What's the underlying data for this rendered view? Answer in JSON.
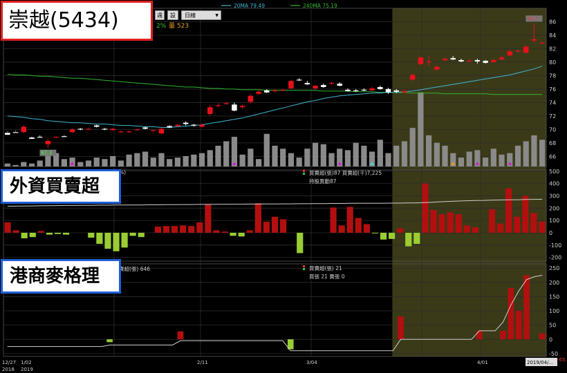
{
  "title": "崇越(5434)",
  "panel_labels": {
    "foreign": "外資買賣超",
    "hk": "港商麥格理"
  },
  "toolbar": {
    "btn1": "週",
    "btn2": "設",
    "period_select": "日線"
  },
  "ma_legend": [
    {
      "label": "20MA 79.49",
      "color": "#3fb7d6"
    },
    {
      "label": "240MA 75.19",
      "color": "#2eb82e"
    }
  ],
  "info_line": {
    "pct": "2%",
    "vol": "量 523"
  },
  "price_labels": {
    "high": "85.7",
    "low": "67.3",
    "last": "-65.8"
  },
  "foreign_info": {
    "line1": "買賣超(張)87  買賣超(千)7,225",
    "line2": "持股異動87",
    "cut": "%)"
  },
  "hk_info": {
    "line1": "買賣超(張) 21",
    "line2": "買張 21  賣張 0",
    "cut": "賣超(張) 646"
  },
  "x_labels": {
    "l1": "12/27",
    "l1b": "2018",
    "l2": "1/02",
    "l2b": "2019",
    "l3": "2/11",
    "l4": "3/04",
    "l5": "4/01",
    "l6": "2019/04/..."
  },
  "colors": {
    "up": "#e8101a",
    "down": "#ffffff",
    "vol": "#8a8a8a",
    "pos_bar": "#b30f0f",
    "neg_bar": "#9acd32",
    "highlight": "#3a3a18",
    "grid": "#2c2c2c"
  },
  "chart_data": [
    {
      "type": "candlestick",
      "title": "崇越(5434)",
      "ylim": [
        64.5,
        88
      ],
      "yticks": [
        66,
        68,
        70,
        72,
        74,
        76,
        78,
        80,
        82,
        84,
        86
      ],
      "candles": [
        [
          69.5,
          69.2,
          69.7,
          69.6
        ],
        [
          69.6,
          69.5,
          69.8,
          69.7
        ],
        [
          69.6,
          70.4,
          70.6,
          69.5
        ],
        [
          68.8,
          68.6,
          68.9,
          68.7
        ],
        [
          68.9,
          68.8,
          69.1,
          68.9
        ],
        [
          67.8,
          68.3,
          68.5,
          67.3
        ],
        [
          68.8,
          68.9,
          69.0,
          68.8
        ],
        [
          69.0,
          68.9,
          69.1,
          68.9
        ],
        [
          69.6,
          70.0,
          70.2,
          69.5
        ],
        [
          70.1,
          70.0,
          70.2,
          69.9
        ],
        [
          70.0,
          70.1,
          70.2,
          69.9
        ],
        [
          70.6,
          70.4,
          70.7,
          70.3
        ],
        [
          70.1,
          70.0,
          70.2,
          69.9
        ],
        [
          69.9,
          70.1,
          70.2,
          69.8
        ],
        [
          69.6,
          69.7,
          69.8,
          69.5
        ],
        [
          69.6,
          69.7,
          69.8,
          69.5
        ],
        [
          69.9,
          70.0,
          70.1,
          69.8
        ],
        [
          70.3,
          70.1,
          70.4,
          70.0
        ],
        [
          69.8,
          69.9,
          70.0,
          69.7
        ],
        [
          69.4,
          70.1,
          70.3,
          69.3
        ],
        [
          70.5,
          70.3,
          70.6,
          70.2
        ],
        [
          70.5,
          70.7,
          70.8,
          70.4
        ],
        [
          71.0,
          70.8,
          71.2,
          70.6
        ],
        [
          70.7,
          70.6,
          70.8,
          70.4
        ],
        [
          70.4,
          70.7,
          70.9,
          70.3
        ],
        [
          72.3,
          73.3,
          73.6,
          72.1
        ],
        [
          73.6,
          73.6,
          73.9,
          73.3
        ],
        [
          73.9,
          73.9,
          74.1,
          73.7
        ],
        [
          73.7,
          72.8,
          74.0,
          72.7
        ],
        [
          73.3,
          73.5,
          73.7,
          73.1
        ],
        [
          74.1,
          75.0,
          75.2,
          73.9
        ],
        [
          75.3,
          75.6,
          75.8,
          75.1
        ],
        [
          75.8,
          75.5,
          76.0,
          75.4
        ],
        [
          75.7,
          75.8,
          76.0,
          75.5
        ],
        [
          75.8,
          75.9,
          76.0,
          75.7
        ],
        [
          76.1,
          77.2,
          77.4,
          76.0
        ],
        [
          77.4,
          77.3,
          77.6,
          77.2
        ],
        [
          76.9,
          76.7,
          77.2,
          76.6
        ],
        [
          76.1,
          76.5,
          76.6,
          75.9
        ],
        [
          76.6,
          76.3,
          76.8,
          76.2
        ],
        [
          76.8,
          76.9,
          77.1,
          76.7
        ],
        [
          76.8,
          76.5,
          77.0,
          76.4
        ],
        [
          75.9,
          75.7,
          76.1,
          75.6
        ],
        [
          75.8,
          75.7,
          76.0,
          75.6
        ],
        [
          75.9,
          75.8,
          76.1,
          75.7
        ],
        [
          75.8,
          76.1,
          76.3,
          75.7
        ],
        [
          76.3,
          76.0,
          76.5,
          75.9
        ],
        [
          76.0,
          75.5,
          76.2,
          75.3
        ],
        [
          75.8,
          75.6,
          76.0,
          75.4
        ],
        [
          75.5,
          75.7,
          75.9,
          75.4
        ],
        [
          77.4,
          78.1,
          78.3,
          77.2
        ],
        [
          79.7,
          80.7,
          80.9,
          79.5
        ],
        [
          80.1,
          80.1,
          80.9,
          79.4
        ],
        [
          78.9,
          79.3,
          79.5,
          78.8
        ],
        [
          80.3,
          80.5,
          80.7,
          80.1
        ],
        [
          80.6,
          80.4,
          80.9,
          80.3
        ],
        [
          80.3,
          80.1,
          80.5,
          80.0
        ],
        [
          80.2,
          80.2,
          80.4,
          80.0
        ],
        [
          80.3,
          80.1,
          80.5,
          79.8
        ],
        [
          80.2,
          79.9,
          80.3,
          79.8
        ],
        [
          80.0,
          80.3,
          80.5,
          79.9
        ],
        [
          80.4,
          80.7,
          80.9,
          80.3
        ],
        [
          81.0,
          81.6,
          81.8,
          80.9
        ],
        [
          81.6,
          81.7,
          81.9,
          81.5
        ],
        [
          81.4,
          82.3,
          82.5,
          81.3
        ],
        [
          83.2,
          83.4,
          85.7,
          82.9
        ],
        [
          82.8,
          82.9,
          83.0,
          82.7
        ]
      ],
      "volume_scale": 48,
      "volume": [
        2,
        1,
        3,
        2,
        4,
        8,
        9,
        5,
        6,
        3,
        4,
        6,
        5,
        7,
        4,
        8,
        9,
        10,
        6,
        9,
        5,
        6,
        7,
        8,
        9,
        11,
        14,
        17,
        20,
        8,
        12,
        5,
        22,
        14,
        12,
        9,
        6,
        12,
        16,
        15,
        9,
        12,
        11,
        16,
        14,
        10,
        18,
        9,
        14,
        17,
        26,
        50,
        21,
        16,
        14,
        9,
        6,
        10,
        11,
        6,
        12,
        8,
        9,
        14,
        17,
        21,
        18
      ],
      "ma20": [
        72.0,
        71.9,
        71.8,
        71.6,
        71.5,
        71.3,
        71.2,
        71.1,
        71.0,
        71.0,
        70.9,
        70.8,
        70.8,
        70.7,
        70.6,
        70.6,
        70.5,
        70.4,
        70.4,
        70.3,
        70.3,
        70.4,
        70.5,
        70.6,
        70.7,
        70.9,
        71.1,
        71.3,
        71.5,
        71.7,
        72.0,
        72.3,
        72.6,
        72.9,
        73.2,
        73.5,
        73.8,
        74.1,
        74.3,
        74.6,
        74.8,
        75.0,
        75.1,
        75.2,
        75.3,
        75.4,
        75.4,
        75.5,
        75.5,
        75.6,
        75.7,
        75.9,
        76.1,
        76.3,
        76.5,
        76.7,
        76.9,
        77.1,
        77.3,
        77.5,
        77.7,
        77.9,
        78.1,
        78.4,
        78.7,
        79.0,
        79.4
      ],
      "ma240": [
        78.2,
        78.1,
        78.1,
        78.0,
        77.9,
        77.9,
        77.8,
        77.7,
        77.6,
        77.6,
        77.5,
        77.4,
        77.3,
        77.2,
        77.1,
        77.0,
        76.9,
        76.8,
        76.7,
        76.6,
        76.5,
        76.4,
        76.3,
        76.3,
        76.2,
        76.1,
        76.1,
        76.0,
        76.0,
        75.9,
        75.9,
        75.9,
        75.8,
        75.8,
        75.8,
        75.8,
        75.8,
        75.8,
        75.8,
        75.7,
        75.7,
        75.7,
        75.7,
        75.6,
        75.6,
        75.6,
        75.5,
        75.5,
        75.5,
        75.5,
        75.4,
        75.4,
        75.4,
        75.4,
        75.3,
        75.3,
        75.3,
        75.3,
        75.3,
        75.3,
        75.2,
        75.2,
        75.2,
        75.2,
        75.2,
        75.2,
        75.2
      ],
      "markers": [
        {
          "i": 8,
          "color": "#d01fd0"
        },
        {
          "i": 28,
          "color": "#d01fd0"
        },
        {
          "i": 41,
          "color": "#d01fd0"
        },
        {
          "i": 45,
          "color": "#4ad0d0"
        },
        {
          "i": 55,
          "color": "#e89a20"
        },
        {
          "i": 58,
          "color": "#d01fd0"
        },
        {
          "i": 62,
          "color": "#d01fd0"
        }
      ]
    },
    {
      "type": "bar",
      "title": "外資買賣超",
      "ylim": [
        -230,
        510
      ],
      "yticks": [
        -200,
        -100,
        0,
        100,
        200,
        300,
        400,
        500
      ],
      "values": [
        85,
        20,
        -45,
        -35,
        15,
        -15,
        -10,
        -15,
        0,
        0,
        -40,
        -90,
        -130,
        -150,
        -120,
        -25,
        -35,
        0,
        50,
        55,
        55,
        60,
        55,
        85,
        230,
        20,
        10,
        -25,
        -30,
        20,
        240,
        90,
        130,
        110,
        0,
        -165,
        0,
        0,
        0,
        205,
        60,
        210,
        120,
        70,
        -5,
        -55,
        -50,
        35,
        -110,
        -90,
        400,
        185,
        150,
        165,
        150,
        60,
        45,
        0,
        190,
        75,
        360,
        130,
        300,
        160,
        90
      ],
      "line": [
        215,
        216,
        217,
        218,
        219,
        220,
        221,
        222,
        222,
        223,
        223,
        224,
        224,
        225,
        225,
        226,
        226,
        227,
        227,
        228,
        228,
        229,
        229,
        230,
        230,
        231,
        231,
        232,
        232,
        233,
        233,
        234,
        234,
        235,
        235,
        236,
        236,
        237,
        237,
        238,
        238,
        239,
        239,
        240,
        240,
        240,
        241,
        241,
        242,
        242,
        245,
        248,
        252,
        255,
        258,
        260,
        262,
        263,
        265,
        266,
        267,
        268,
        270,
        271,
        272
      ]
    },
    {
      "type": "bar",
      "title": "港商麥格理",
      "ylim": [
        -60,
        265
      ],
      "yticks": [
        -50,
        0,
        50,
        100,
        150,
        200,
        250
      ],
      "values": [
        0,
        0,
        0,
        0,
        0,
        0,
        0,
        0,
        0,
        0,
        0,
        0,
        0,
        -10,
        0,
        0,
        0,
        0,
        0,
        0,
        0,
        0,
        28,
        0,
        0,
        0,
        0,
        0,
        0,
        0,
        0,
        0,
        0,
        0,
        0,
        0,
        -35,
        0,
        0,
        0,
        0,
        0,
        0,
        0,
        0,
        0,
        0,
        0,
        0,
        0,
        80,
        0,
        0,
        0,
        0,
        0,
        0,
        0,
        0,
        0,
        30,
        0,
        0,
        30,
        180,
        100,
        225,
        0,
        21
      ],
      "line": [
        -25,
        -25,
        -25,
        -25,
        -25,
        -25,
        -25,
        -25,
        -25,
        -25,
        -25,
        -25,
        -25,
        -20,
        -20,
        -20,
        -20,
        -20,
        -20,
        -20,
        -20,
        -20,
        -5,
        -5,
        -5,
        -5,
        -5,
        -5,
        -5,
        -5,
        -5,
        -5,
        -5,
        -5,
        -5,
        -5,
        -40,
        -40,
        -40,
        -40,
        -40,
        -40,
        -40,
        -40,
        -40,
        -40,
        -40,
        -40,
        -40,
        -40,
        0,
        0,
        0,
        0,
        0,
        0,
        0,
        0,
        0,
        0,
        30,
        30,
        30,
        60,
        120,
        170,
        210,
        220,
        225
      ]
    }
  ]
}
